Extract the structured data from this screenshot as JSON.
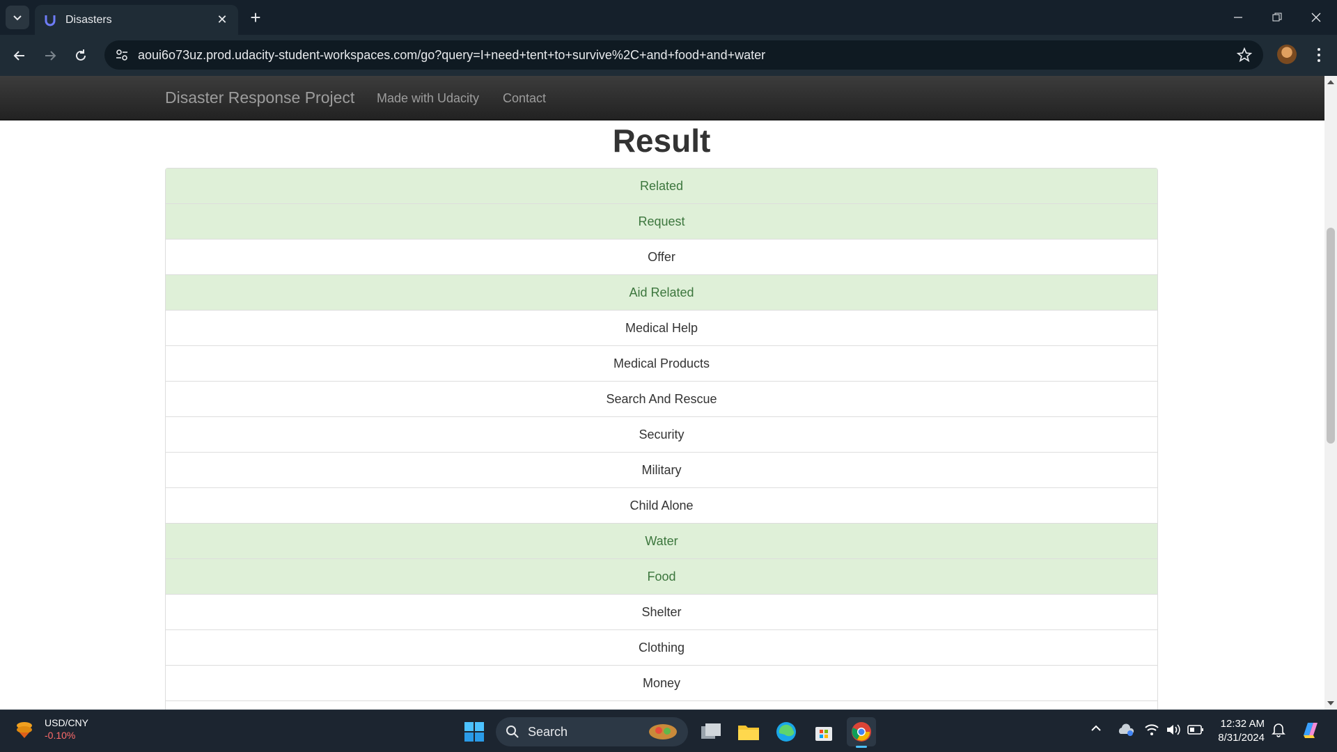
{
  "browser": {
    "tab_title": "Disasters",
    "url": "aoui6o73uz.prod.udacity-student-workspaces.com/go?query=I+need+tent+to+survive%2C+and+food+and+water"
  },
  "navbar": {
    "brand": "Disaster Response Project",
    "links": [
      "Made with Udacity",
      "Contact"
    ]
  },
  "page": {
    "title": "Result",
    "categories": [
      {
        "label": "Related",
        "matched": true
      },
      {
        "label": "Request",
        "matched": true
      },
      {
        "label": "Offer",
        "matched": false
      },
      {
        "label": "Aid Related",
        "matched": true
      },
      {
        "label": "Medical Help",
        "matched": false
      },
      {
        "label": "Medical Products",
        "matched": false
      },
      {
        "label": "Search And Rescue",
        "matched": false
      },
      {
        "label": "Security",
        "matched": false
      },
      {
        "label": "Military",
        "matched": false
      },
      {
        "label": "Child Alone",
        "matched": false
      },
      {
        "label": "Water",
        "matched": true
      },
      {
        "label": "Food",
        "matched": true
      },
      {
        "label": "Shelter",
        "matched": false
      },
      {
        "label": "Clothing",
        "matched": false
      },
      {
        "label": "Money",
        "matched": false
      },
      {
        "label": "",
        "matched": false
      }
    ]
  },
  "colors": {
    "matched_bg": "#dff0d8",
    "matched_text": "#3c763d"
  },
  "taskbar": {
    "widget_title": "USD/CNY",
    "widget_value": "-0.10%",
    "search_label": "Search",
    "time": "12:32 AM",
    "date": "8/31/2024"
  }
}
